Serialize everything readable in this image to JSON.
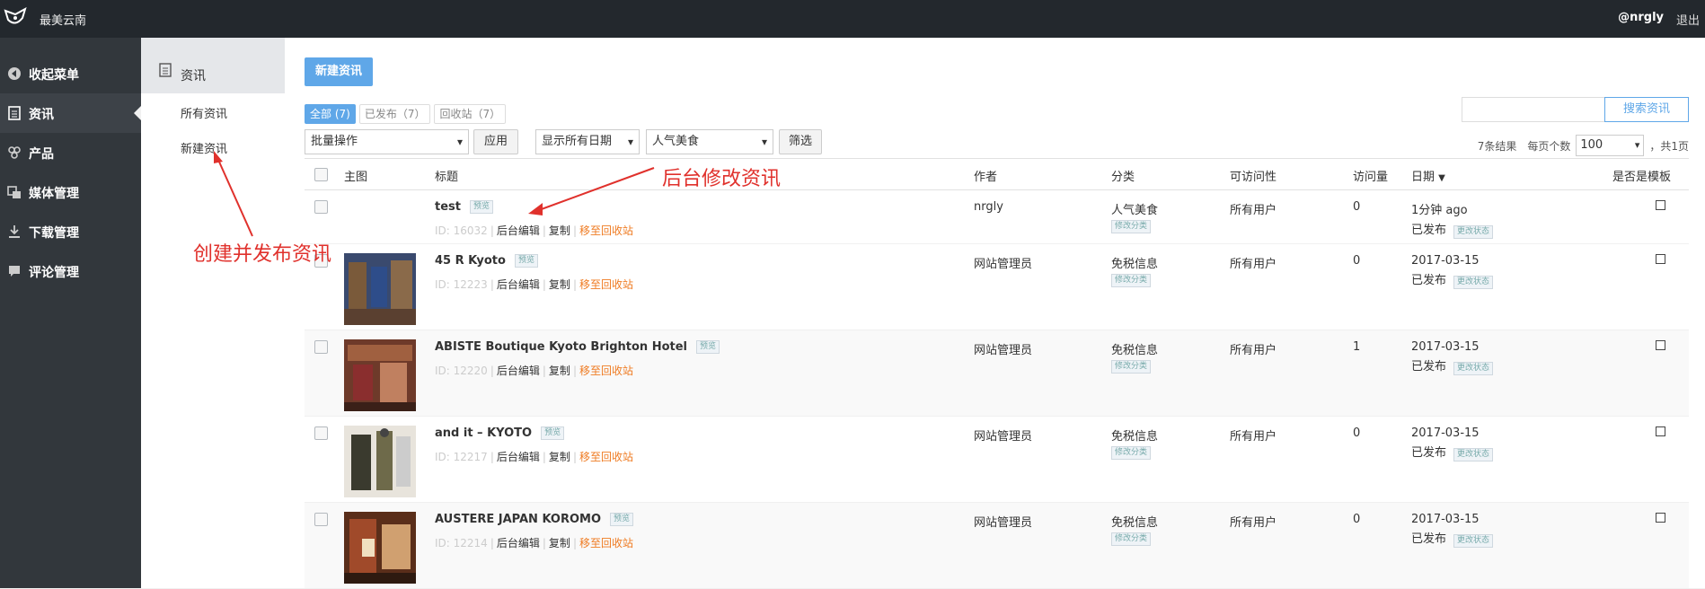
{
  "topbar": {
    "site_name": "最美云南",
    "user": "@nrgly",
    "logout": "退出"
  },
  "sidebar": {
    "items": [
      {
        "label": "收起菜单",
        "icon": "collapse-icon"
      },
      {
        "label": "资讯",
        "icon": "document-icon",
        "active": true
      },
      {
        "label": "产品",
        "icon": "cubes-icon"
      },
      {
        "label": "媒体管理",
        "icon": "media-icon"
      },
      {
        "label": "下载管理",
        "icon": "download-icon"
      },
      {
        "label": "评论管理",
        "icon": "comment-icon"
      }
    ]
  },
  "subnav": {
    "title": "资讯",
    "all": "所有资讯",
    "new": "新建资讯"
  },
  "toolbar": {
    "new_button": "新建资讯",
    "filters": [
      "全部 (7)",
      "已发布（7）",
      "回收站（7）"
    ],
    "bulk": "批量操作",
    "apply": "应用",
    "date_filter": "显示所有日期",
    "category_filter": "人气美食",
    "filter_button": "筛选",
    "search_button": "搜索资讯",
    "search_placeholder": "",
    "results": "7条结果",
    "per_page_label": "每页个数",
    "per_page": "100",
    "total_pages": "，共1页"
  },
  "table": {
    "headers": [
      "主图",
      "标题",
      "作者",
      "分类",
      "可访问性",
      "访问量",
      "日期",
      "是否是模板"
    ],
    "preview_tag": "预览",
    "edit_label": "后台编辑",
    "copy_label": "复制",
    "trash_label": "移至回收站",
    "change_cat": "修改分类",
    "change_status": "更改状态",
    "rows": [
      {
        "title": "test",
        "id": "ID: 16032",
        "author": "nrgly",
        "category": "人气美食",
        "access": "所有用户",
        "views": "0",
        "date": "1分钟 ago",
        "status": "已发布",
        "thumb": ""
      },
      {
        "title": "45 R Kyoto",
        "id": "ID: 12223",
        "author": "网站管理员",
        "category": "免税信息",
        "access": "所有用户",
        "views": "0",
        "date": "2017-03-15",
        "status": "已发布",
        "thumb": "blue-shop"
      },
      {
        "title": "ABISTE Boutique Kyoto Brighton Hotel",
        "id": "ID: 12220",
        "author": "网站管理员",
        "category": "免税信息",
        "access": "所有用户",
        "views": "1",
        "date": "2017-03-15",
        "status": "已发布",
        "thumb": "red-shop"
      },
      {
        "title": "and it – KYOTO",
        "id": "ID: 12217",
        "author": "网站管理员",
        "category": "免税信息",
        "access": "所有用户",
        "views": "0",
        "date": "2017-03-15",
        "status": "已发布",
        "thumb": "mannequin"
      },
      {
        "title": "AUSTERE JAPAN KOROMO",
        "id": "ID: 12214",
        "author": "网站管理员",
        "category": "免税信息",
        "access": "所有用户",
        "views": "0",
        "date": "2017-03-15",
        "status": "已发布",
        "thumb": "warm-shop"
      }
    ]
  },
  "annotations": {
    "edit_note": "后台修改资讯",
    "create_note": "创建并发布资讯"
  },
  "colors": {
    "accent": "#5fa7e8",
    "trash": "#ef7b22",
    "annotation": "#e0312c",
    "topbar": "#23282d",
    "sidebar": "#32373c"
  }
}
